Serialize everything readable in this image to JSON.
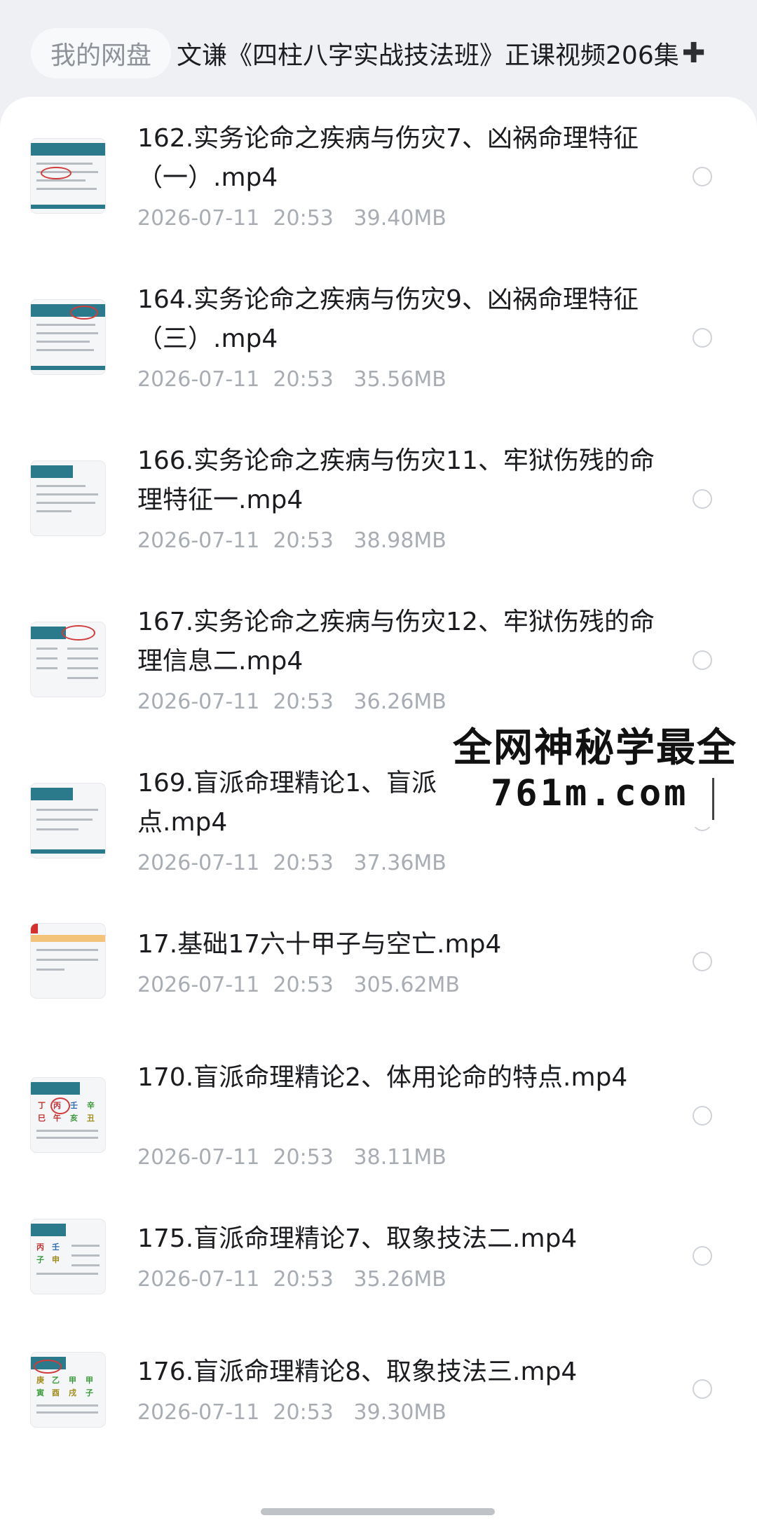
{
  "header": {
    "root_label": "我的网盘",
    "current_folder": "文谦《四柱八字实战技法班》正课视频206集",
    "add_icon": "plus-icon"
  },
  "files": [
    {
      "title": "162.实务论命之疾病与伤灾7、凶祸命理特征（一）.mp4",
      "date": "2026-07-11",
      "time": "20:53",
      "size": "39.40MB"
    },
    {
      "title": "164.实务论命之疾病与伤灾9、凶祸命理特征（三）.mp4",
      "date": "2026-07-11",
      "time": "20:53",
      "size": "35.56MB"
    },
    {
      "title": "166.实务论命之疾病与伤灾11、牢狱伤残的命理特征一.mp4",
      "date": "2026-07-11",
      "time": "20:53",
      "size": "38.98MB"
    },
    {
      "title": "167.实务论命之疾病与伤灾12、牢狱伤残的命理信息二.mp4",
      "date": "2026-07-11",
      "time": "20:53",
      "size": "36.26MB"
    },
    {
      "title": "169.盲派命理精论1、盲派\n点.mp4",
      "date": "2026-07-11",
      "time": "20:53",
      "size": "37.36MB"
    },
    {
      "title": "17.基础17六十甲子与空亡.mp4",
      "date": "2026-07-11",
      "time": "20:53",
      "size": "305.62MB"
    },
    {
      "title": "170.盲派命理精论2、体用论命的特点.mp4",
      "date": "2026-07-11",
      "time": "20:53",
      "size": "38.11MB"
    },
    {
      "title": "175.盲派命理精论7、取象技法二.mp4",
      "date": "2026-07-11",
      "time": "20:53",
      "size": "35.26MB"
    },
    {
      "title": "176.盲派命理精论8、取象技法三.mp4",
      "date": "2026-07-11",
      "time": "20:53",
      "size": "39.30MB"
    }
  ],
  "watermark": {
    "line1": "全网神秘学最全",
    "line2": "761m.com"
  }
}
